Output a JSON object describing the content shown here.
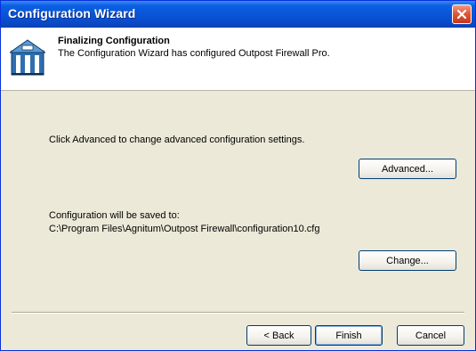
{
  "window": {
    "title": "Configuration Wizard"
  },
  "header": {
    "title": "Finalizing Configuration",
    "subtitle": "The Configuration Wizard has configured Outpost Firewall Pro.",
    "icon": "firewall-tower-icon"
  },
  "main": {
    "advanced_text": "Click Advanced to change advanced configuration settings.",
    "advanced_button": "Advanced...",
    "save_label": "Configuration will be saved to:",
    "save_path": "C:\\Program Files\\Agnitum\\Outpost Firewall\\configuration10.cfg",
    "change_button": "Change..."
  },
  "footer": {
    "back_button": "< Back",
    "finish_button": "Finish",
    "cancel_button": "Cancel"
  },
  "colors": {
    "titlebar": "#0a53d6",
    "dialog_bg": "#ece9d8",
    "close_button": "#e05a3a"
  }
}
